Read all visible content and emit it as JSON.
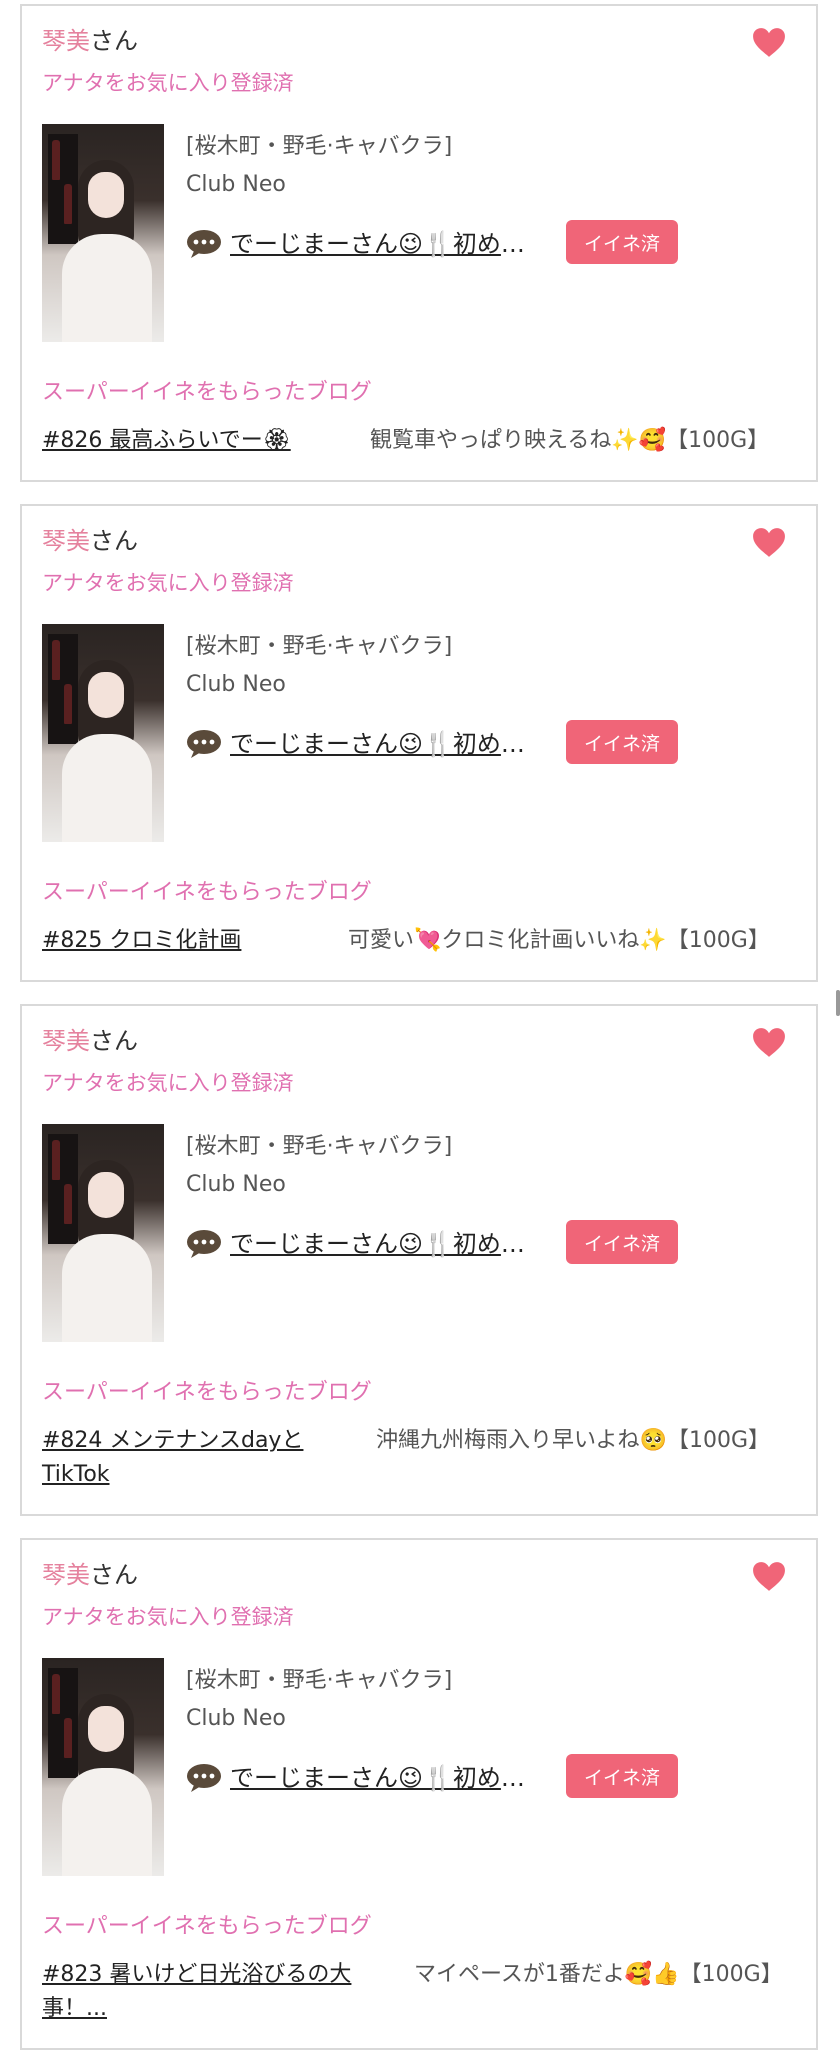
{
  "colors": {
    "pink_name": "#e5829e",
    "pink_label": "#e070b0",
    "heart": "#f06578",
    "button_bg": "#f06578"
  },
  "cards": [
    {
      "cast_name": "琴美",
      "name_suffix": "さん",
      "fav_status": "アナタをお気に入り登録済",
      "shop_area": "[桜木町・野毛·キャバクラ]",
      "shop_name": "Club Neo",
      "blog_title": "でーじまーさん😉🍴初めてのお客さんありがとうございました",
      "iine_button": "イイネ済",
      "super_heading": "スーパーイイネをもらったブログ",
      "post_title": "#826 最高ふらいでー🏵",
      "post_comment": "観覧車やっぱり映えるね✨🥰【100G】"
    },
    {
      "cast_name": "琴美",
      "name_suffix": "さん",
      "fav_status": "アナタをお気に入り登録済",
      "shop_area": "[桜木町・野毛·キャバクラ]",
      "shop_name": "Club Neo",
      "blog_title": "でーじまーさん😉🍴初めてのお客さんありがとうございました",
      "iine_button": "イイネ済",
      "super_heading": "スーパーイイネをもらったブログ",
      "post_title": "#825 クロミ化計画",
      "post_comment": "可愛い💘クロミ化計画いいね✨【100G】"
    },
    {
      "cast_name": "琴美",
      "name_suffix": "さん",
      "fav_status": "アナタをお気に入り登録済",
      "shop_area": "[桜木町・野毛·キャバクラ]",
      "shop_name": "Club Neo",
      "blog_title": "でーじまーさん😉🍴初めてのお客さんありがとうございました",
      "iine_button": "イイネ済",
      "super_heading": "スーパーイイネをもらったブログ",
      "post_title": "#824 メンテナンスdayとTikTok",
      "post_comment": "沖縄九州梅雨入り早いよね🥺【100G】"
    },
    {
      "cast_name": "琴美",
      "name_suffix": "さん",
      "fav_status": "アナタをお気に入り登録済",
      "shop_area": "[桜木町・野毛·キャバクラ]",
      "shop_name": "Club Neo",
      "blog_title": "でーじまーさん😉🍴初めてのお客さんありがとうございました",
      "iine_button": "イイネ済",
      "super_heading": "スーパーイイネをもらったブログ",
      "post_title": "#823 暑いけど日光浴びるの大事！...",
      "post_comment": "マイペースが1番だよ🥰👍【100G】"
    }
  ]
}
